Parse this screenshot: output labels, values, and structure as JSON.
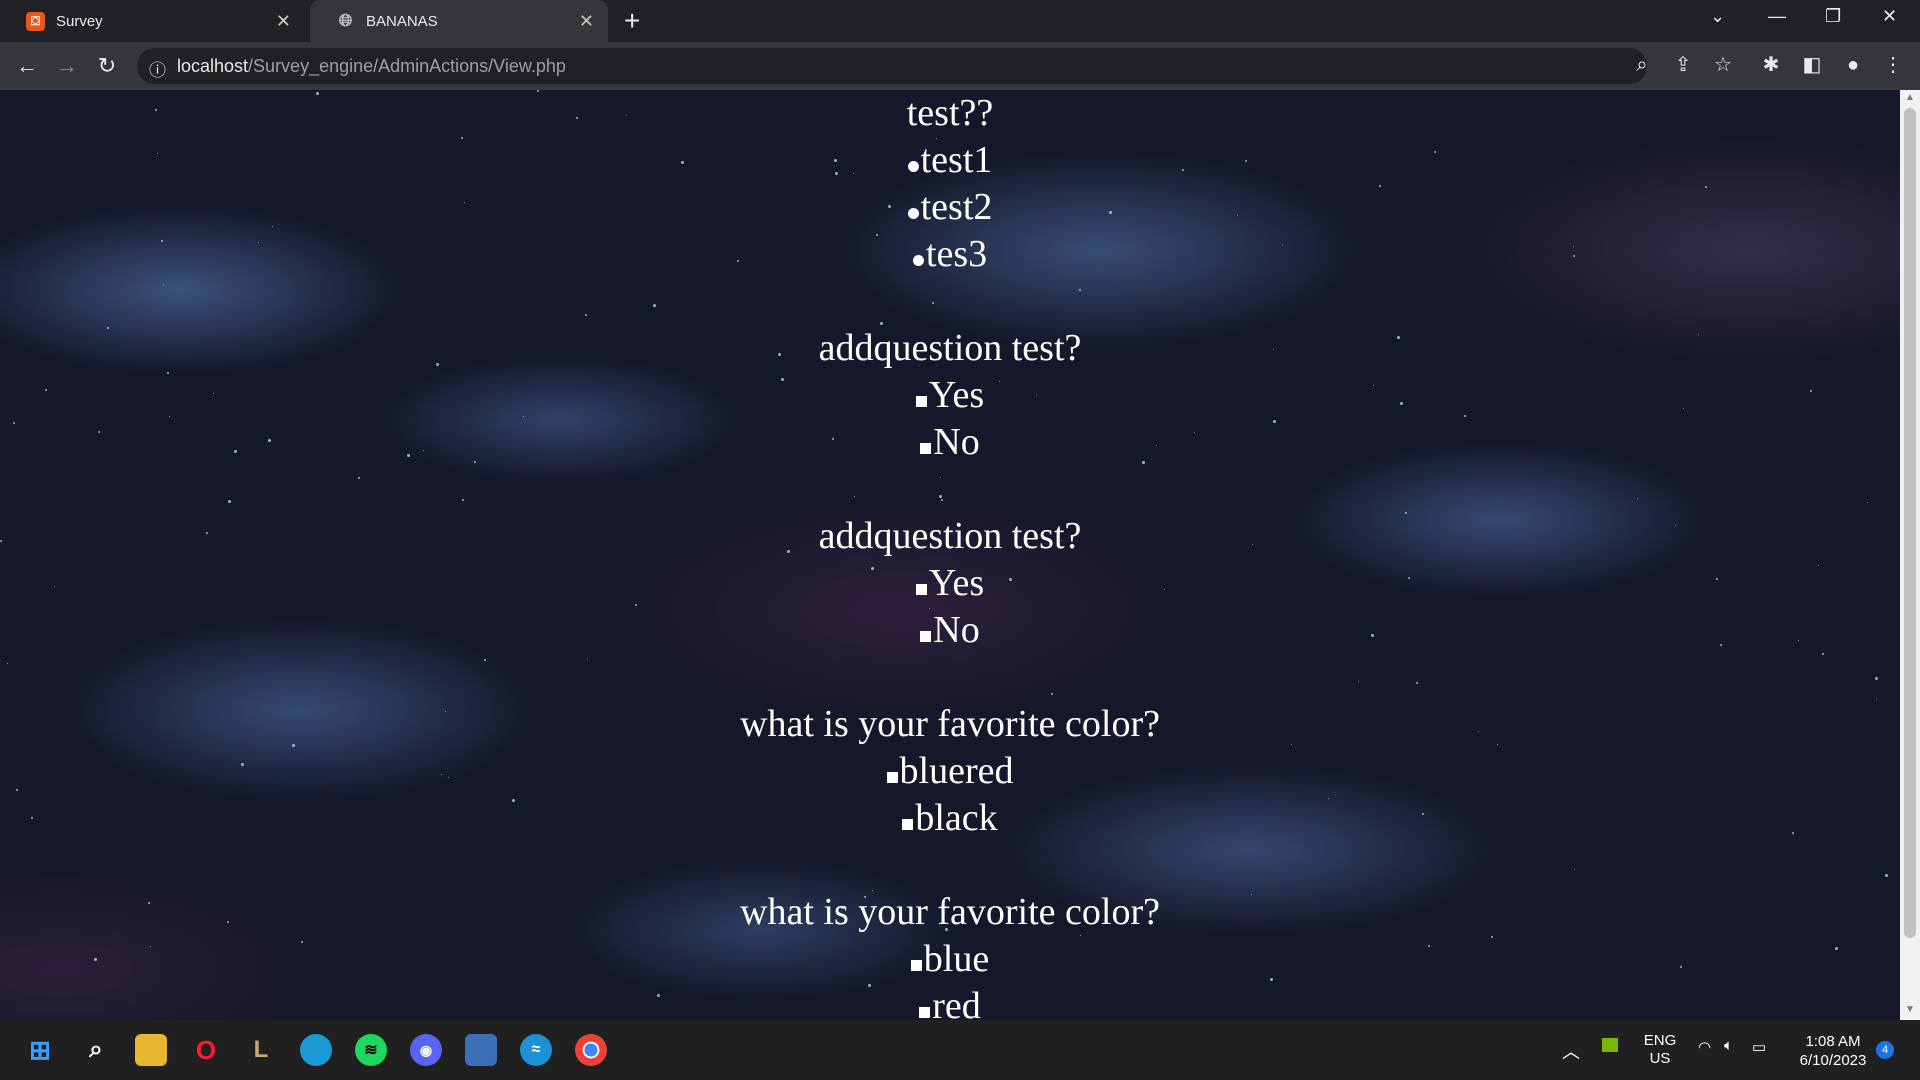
{
  "browser": {
    "tabs": [
      {
        "label": "Survey",
        "active": false
      },
      {
        "label": "BANANAS",
        "active": true
      }
    ],
    "url_host": "localhost",
    "url_path": "/Survey_engine/AdminActions/View.php"
  },
  "survey": {
    "questions": [
      {
        "text": "test??",
        "options": [
          "test1",
          "test2",
          "tes3"
        ]
      },
      {
        "text": "addquestion test?",
        "options": [
          "Yes",
          "No"
        ]
      },
      {
        "text": "addquestion test?",
        "options": [
          "Yes",
          "No"
        ]
      },
      {
        "text": "what is your favorite color?",
        "options": [
          "bluered",
          "black"
        ]
      },
      {
        "text": "what is your favorite color?",
        "options": [
          "blue",
          "red"
        ]
      }
    ]
  },
  "system_tray": {
    "lang": "ENG",
    "region": "US",
    "time": "1:08 AM",
    "date": "6/10/2023",
    "notifications": "4"
  },
  "colors": {
    "page_text": "#ffffff",
    "chrome_dark": "#202124",
    "chrome_toolbar": "#35363a"
  }
}
